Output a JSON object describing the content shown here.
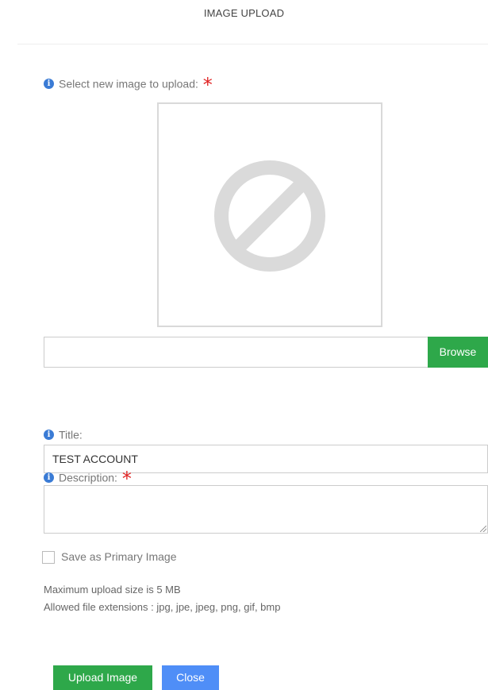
{
  "modal": {
    "title": "IMAGE UPLOAD"
  },
  "image_select": {
    "label": "Select new image to upload:",
    "required_mark": "*",
    "preview_icon": "no-image-icon",
    "file_value": "",
    "browse_label": "Browse"
  },
  "title_field": {
    "label": "Title:",
    "value": "TEST ACCOUNT"
  },
  "description_field": {
    "label": "Description:",
    "required_mark": "*",
    "value": ""
  },
  "primary_checkbox": {
    "label": "Save as Primary Image",
    "checked": false
  },
  "hints": {
    "max_size": "Maximum upload size is 5 MB",
    "extensions": "Allowed file extensions : jpg, jpe, jpeg, png, gif, bmp"
  },
  "actions": {
    "upload_label": "Upload Image",
    "close_label": "Close"
  },
  "colors": {
    "success": "#2ea84a",
    "primary": "#4f8ef7",
    "info": "#3a7bd5",
    "required": "#e02424"
  }
}
